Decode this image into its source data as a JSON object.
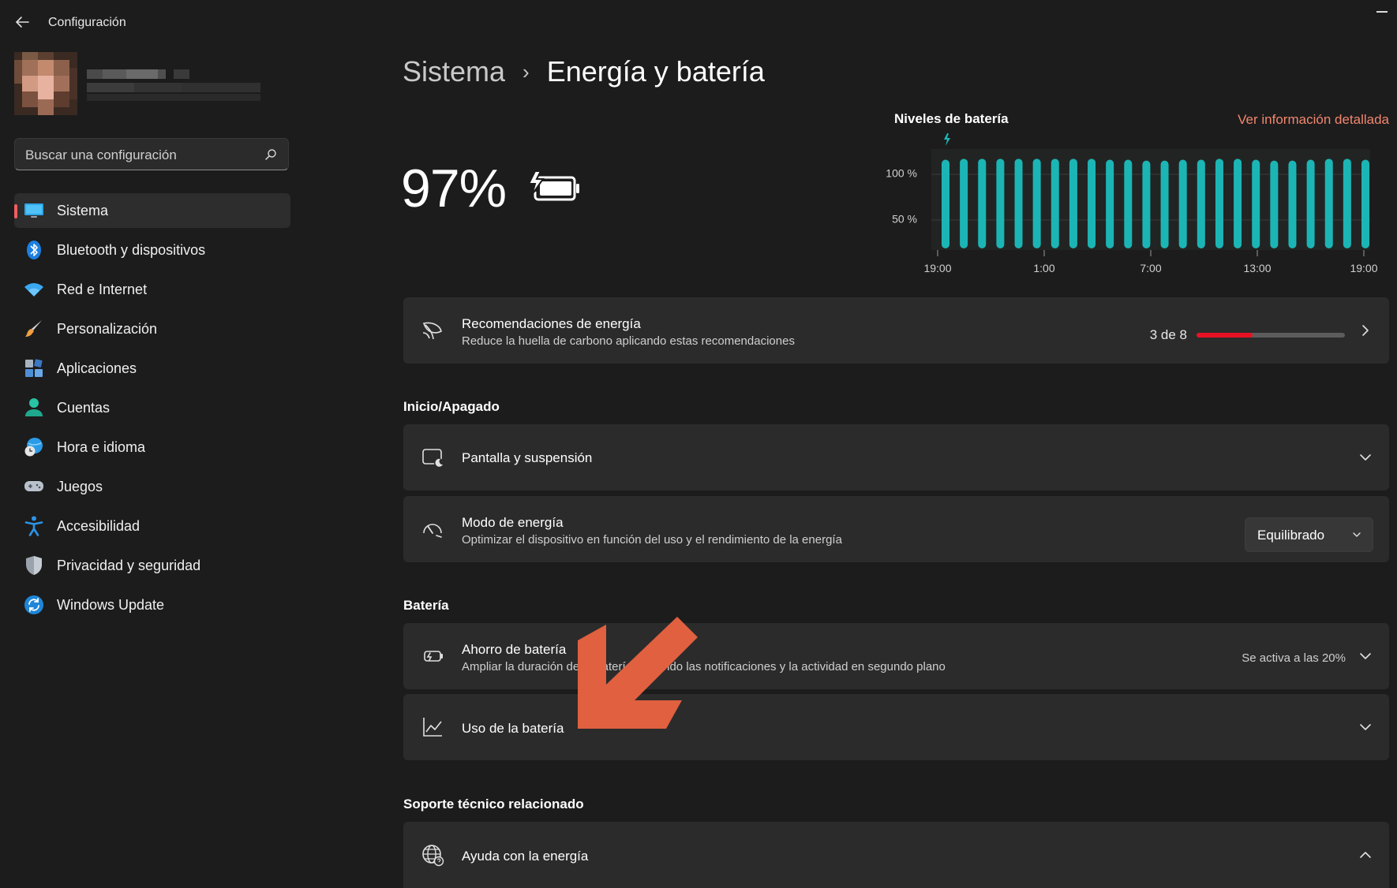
{
  "window": {
    "title": "Configuración"
  },
  "sidebar": {
    "search_placeholder": "Buscar una configuración",
    "items": [
      {
        "label": "Sistema",
        "icon": "monitor-icon",
        "selected": true
      },
      {
        "label": "Bluetooth y dispositivos",
        "icon": "bluetooth-icon"
      },
      {
        "label": "Red e Internet",
        "icon": "wifi-icon"
      },
      {
        "label": "Personalización",
        "icon": "brush-icon"
      },
      {
        "label": "Aplicaciones",
        "icon": "apps-icon"
      },
      {
        "label": "Cuentas",
        "icon": "account-icon"
      },
      {
        "label": "Hora e idioma",
        "icon": "globe-clock-icon"
      },
      {
        "label": "Juegos",
        "icon": "gamepad-icon"
      },
      {
        "label": "Accesibilidad",
        "icon": "accessibility-icon"
      },
      {
        "label": "Privacidad y seguridad",
        "icon": "shield-icon"
      },
      {
        "label": "Windows Update",
        "icon": "update-icon"
      }
    ]
  },
  "breadcrumb": {
    "parent": "Sistema",
    "separator": "›",
    "current": "Energía y batería"
  },
  "battery": {
    "percent": "97%",
    "charging": true
  },
  "chart_data": {
    "type": "bar",
    "title": "Niveles de batería",
    "link": "Ver información detallada",
    "y_ticks": [
      "100 %",
      "50 %"
    ],
    "x_ticks": [
      "19:00",
      "1:00",
      "7:00",
      "13:00",
      "19:00"
    ],
    "ylim": [
      0,
      100
    ],
    "values": [
      97,
      98,
      98,
      98,
      98,
      98,
      98,
      98,
      98,
      97,
      97,
      96,
      96,
      97,
      97,
      98,
      98,
      97,
      96,
      96,
      97,
      98,
      98,
      97
    ],
    "bar_color": "#1cb5b5",
    "grid": true
  },
  "recommendations": {
    "title": "Recomendaciones de energía",
    "subtitle": "Reduce la huella de carbono aplicando estas recomendaciones",
    "count_label": "3 de 8",
    "progress": 0.375
  },
  "section_power": {
    "title": "Inicio/Apagado"
  },
  "screen_sleep": {
    "title": "Pantalla y suspensión"
  },
  "power_mode": {
    "title": "Modo de energía",
    "subtitle": "Optimizar el dispositivo en función del uso y el rendimiento de la energía",
    "value": "Equilibrado"
  },
  "section_battery": {
    "title": "Batería"
  },
  "battery_saver": {
    "title": "Ahorro de batería",
    "subtitle": "Ampliar la duración de la batería limitando las notificaciones y la actividad en segundo plano",
    "status": "Se activa a las 20%"
  },
  "battery_usage": {
    "title": "Uso de la batería"
  },
  "section_support": {
    "title": "Soporte técnico relacionado"
  },
  "energy_help": {
    "title": "Ayuda con la energía"
  },
  "colors": {
    "accent_red": "#ee5e62",
    "link": "#f1866f",
    "progress": "#e81123",
    "arrow": "#e0603f"
  }
}
